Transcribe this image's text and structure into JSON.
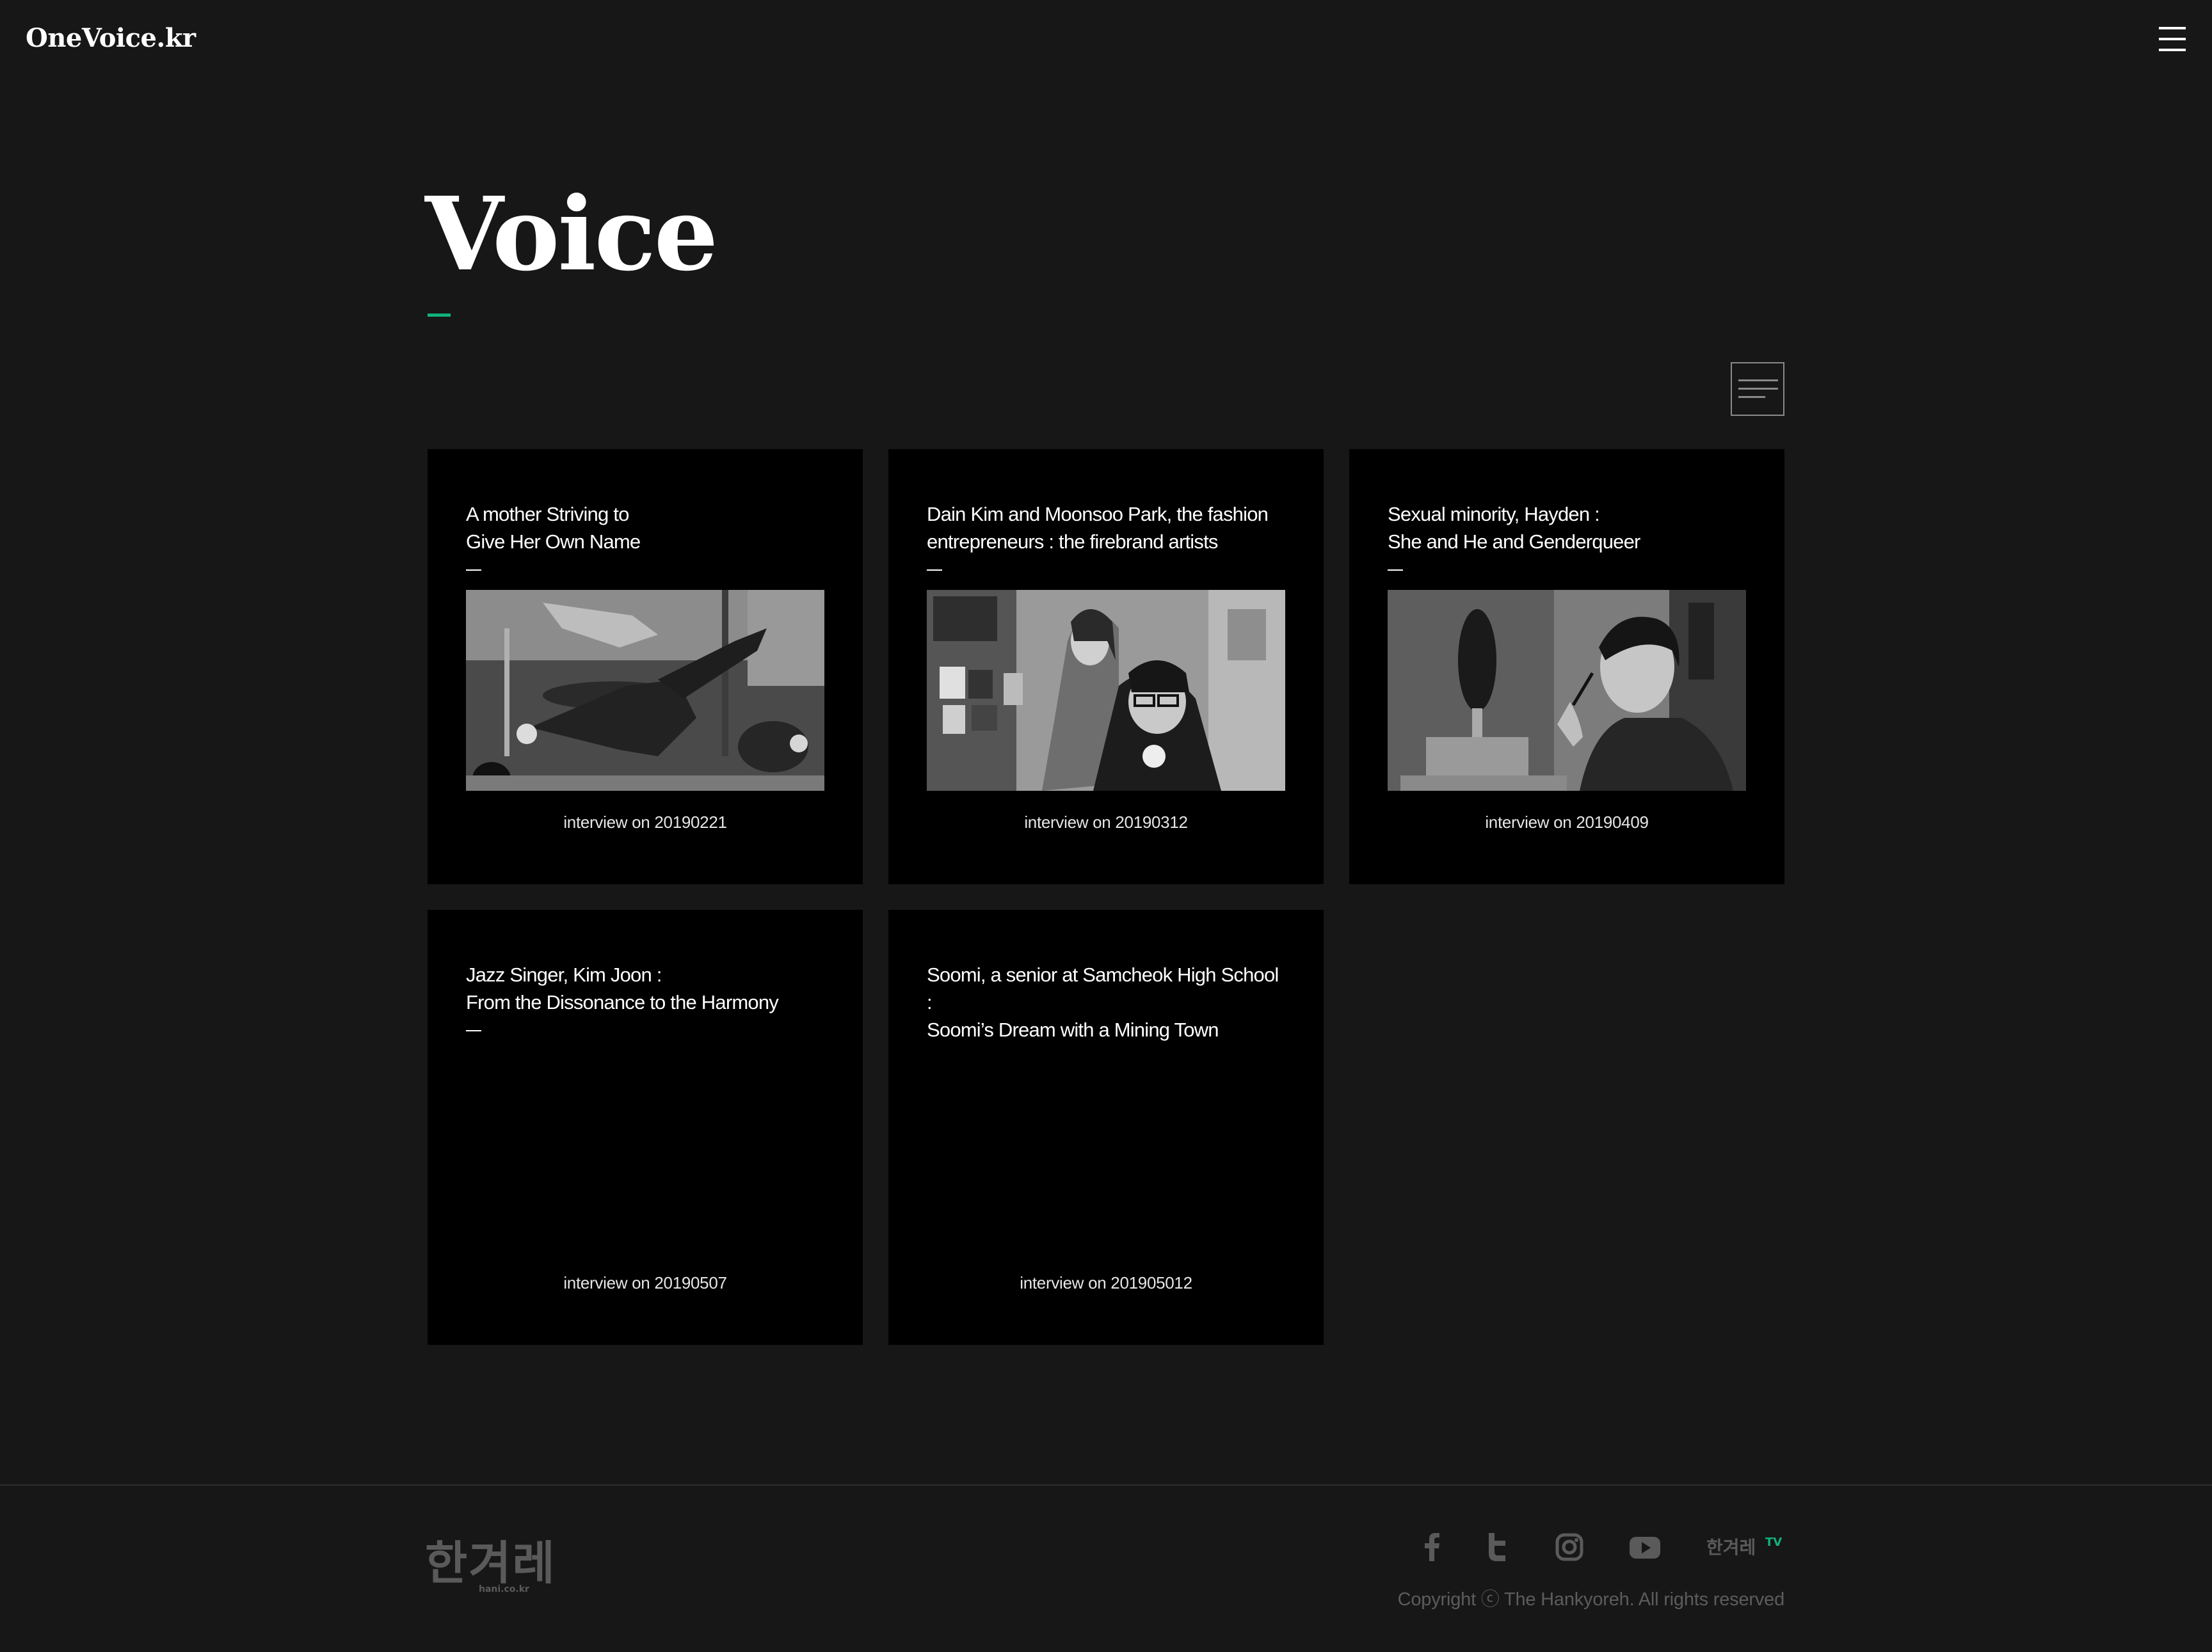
{
  "header": {
    "logo": "OneVoice.kr",
    "menu_icon": "hamburger-menu-icon"
  },
  "main": {
    "title": "Voice",
    "accent_color": "#12b27a",
    "view_toggle_icon": "list-view-icon",
    "cards": [
      {
        "title": "A mother Striving to\nGive Her Own Name",
        "date": "interview on 20190221",
        "image": "black-and-white photo of women exercising on mats in a fitness studio"
      },
      {
        "title": "Dain Kim and Moonsoo Park, the fashion\nentrepreneurs : the firebrand artists",
        "date": "interview on 20190312",
        "image": "black-and-white photo of two people wearing glasses in an art studio"
      },
      {
        "title": "Sexual minority, Hayden :\nShe and He and Genderqueer",
        "date": "interview on 20190409",
        "image": "black-and-white photo of a young person applying makeup near a mirror"
      },
      {
        "title": "Jazz Singer, Kim Joon :\nFrom the Dissonance to the Harmony",
        "date": "interview on 20190507"
      },
      {
        "title": "Soomi, a senior at Samcheok High School\n:\nSoomi’s Dream with a Mining Town",
        "date": "interview on 201905012"
      }
    ]
  },
  "footer": {
    "logo_text": "한겨레",
    "logo_sub": "hani.co.kr",
    "social": [
      {
        "name": "facebook",
        "icon": "facebook-icon"
      },
      {
        "name": "twitter",
        "icon": "twitter-icon"
      },
      {
        "name": "instagram",
        "icon": "instagram-icon"
      },
      {
        "name": "youtube",
        "icon": "youtube-icon"
      }
    ],
    "hani_tv_label": "한겨레",
    "hani_tv_suffix": "TV",
    "copyright": "Copyright ⓒ The Hankyoreh. All rights reserved"
  }
}
